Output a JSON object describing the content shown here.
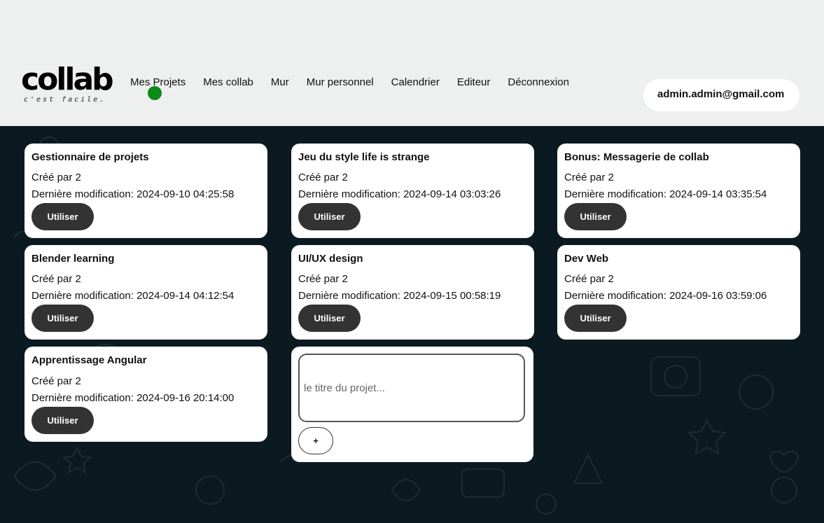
{
  "header": {
    "logo_text": "collab",
    "logo_tagline": "c'est facile.",
    "nav": [
      "Mes Projets",
      "Mes collab",
      "Mur",
      "Mur personnel",
      "Calendrier",
      "Editeur",
      "Déconnexion"
    ],
    "user_email": "admin.admin@gmail.com",
    "status_color": "#0e8a17"
  },
  "projects": [
    {
      "title": "Gestionnaire de projets",
      "created_by": "Créé par 2",
      "modified": "Dernière modification: 2024-09-10 04:25:58",
      "button": "Utiliser"
    },
    {
      "title": "Jeu du style life is strange",
      "created_by": "Créé par 2",
      "modified": "Dernière modification: 2024-09-14 03:03:26",
      "button": "Utiliser"
    },
    {
      "title": "Bonus: Messagerie de collab",
      "created_by": "Créé par 2",
      "modified": "Dernière modification: 2024-09-14 03:35:54",
      "button": "Utiliser"
    },
    {
      "title": "Blender learning",
      "created_by": "Créé par 2",
      "modified": "Dernière modification: 2024-09-14 04:12:54",
      "button": "Utiliser"
    },
    {
      "title": "UI/UX design",
      "created_by": "Créé par 2",
      "modified": "Dernière modification: 2024-09-15 00:58:19",
      "button": "Utiliser"
    },
    {
      "title": "Dev Web",
      "created_by": "Créé par 2",
      "modified": "Dernière modification: 2024-09-16 03:59:06",
      "button": "Utiliser"
    },
    {
      "title": "Apprentissage Angular",
      "created_by": "Créé par 2",
      "modified": "Dernière modification: 2024-09-16 20:14:00",
      "button": "Utiliser"
    }
  ],
  "new_project": {
    "placeholder": "le titre du projet...",
    "value": "",
    "add_label": "+"
  },
  "colors": {
    "header_bg": "#eeefef",
    "page_bg": "#0b1a20",
    "button_dark": "#333333"
  }
}
